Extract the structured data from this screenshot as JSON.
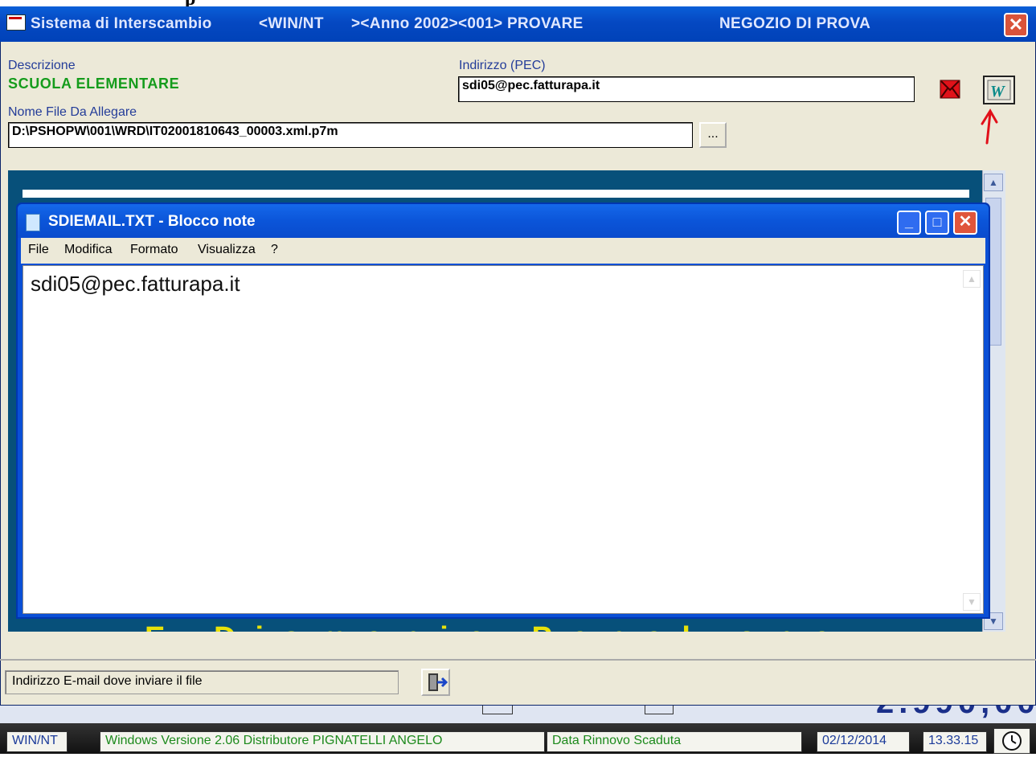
{
  "fragment_top": "p",
  "window": {
    "title_segments": [
      "Sistema di Interscambio",
      "<WIN/NT",
      "><Anno 2002><001> PROVARE",
      "NEGOZIO DI PROVA"
    ],
    "close_glyph": "✕",
    "icon": "app-window-icon"
  },
  "form": {
    "descrizione_label": "Descrizione",
    "descrizione_value": "SCUOLA ELEMENTARE",
    "pec_label": "Indirizzo (PEC)",
    "pec_value": "sdi05@pec.fatturapa.it",
    "file_label": "Nome File Da Allegare",
    "file_value": "D:\\PSHOPW\\001\\WRD\\IT02001810643_00003.xml.p7m",
    "browse_label": "...",
    "send_mail_icon": "envelope-icon",
    "notepad_icon": "wordpad-icon"
  },
  "background_panel": {
    "scroll_text": "E-Dismanic Penal one Conducting - Tl Conf (Coftware)",
    "brand_color": "#07507a",
    "text_color": "#e8e20a"
  },
  "notepad": {
    "title": "SDIEMAIL.TXT - Blocco note",
    "menu": [
      "File",
      "Modifica",
      "Formato",
      "Visualizza",
      "?"
    ],
    "content": "sdi05@pec.fatturapa.it",
    "min_glyph": "_",
    "max_glyph": "□",
    "close_glyph": "✕"
  },
  "status_text": "Indirizzo E-mail dove inviare il file",
  "exit_icon": "exit-door-icon",
  "taskbar": {
    "os": "WIN/NT",
    "info": "Windows   Versione 2.06 Distributore PIGNATELLI ANGELO",
    "renewal": "Data Rinnovo Scaduta",
    "date": "02/12/2014",
    "time": "13.33.15",
    "clock_icon": "clock-icon"
  }
}
